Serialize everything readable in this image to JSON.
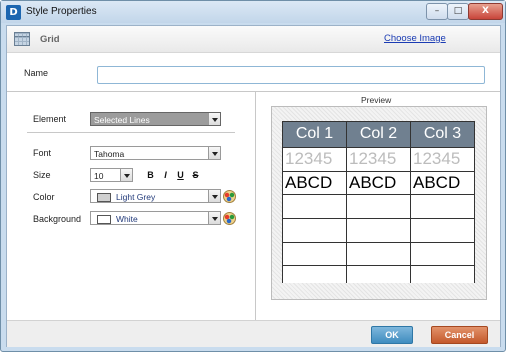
{
  "window": {
    "title": "Style Properties",
    "app_icon_letter": "D",
    "min_glyph": "–",
    "max_glyph": "□",
    "close_glyph": "X"
  },
  "header": {
    "title": "Grid",
    "choose_image": "Choose Image"
  },
  "form": {
    "name_label": "Name",
    "name_value": "",
    "element_label": "Element",
    "element_value": "Selected Lines",
    "font_label": "Font",
    "font_value": "Tahoma",
    "size_label": "Size",
    "size_value": "10",
    "bold": "B",
    "italic": "I",
    "underline": "U",
    "strike": "S",
    "color_label": "Color",
    "color_value": "Light Grey",
    "color_hex": "#d0d0d0",
    "background_label": "Background",
    "background_value": "White",
    "background_hex": "#ffffff"
  },
  "preview": {
    "label": "Preview",
    "headers": [
      "Col 1",
      "Col 2",
      "Col 3"
    ],
    "line_row": [
      "12345",
      "12345",
      "12345"
    ],
    "text_row": [
      "ABCD",
      "ABCD",
      "ABCD"
    ]
  },
  "buttons": {
    "ok": "OK",
    "cancel": "Cancel"
  }
}
